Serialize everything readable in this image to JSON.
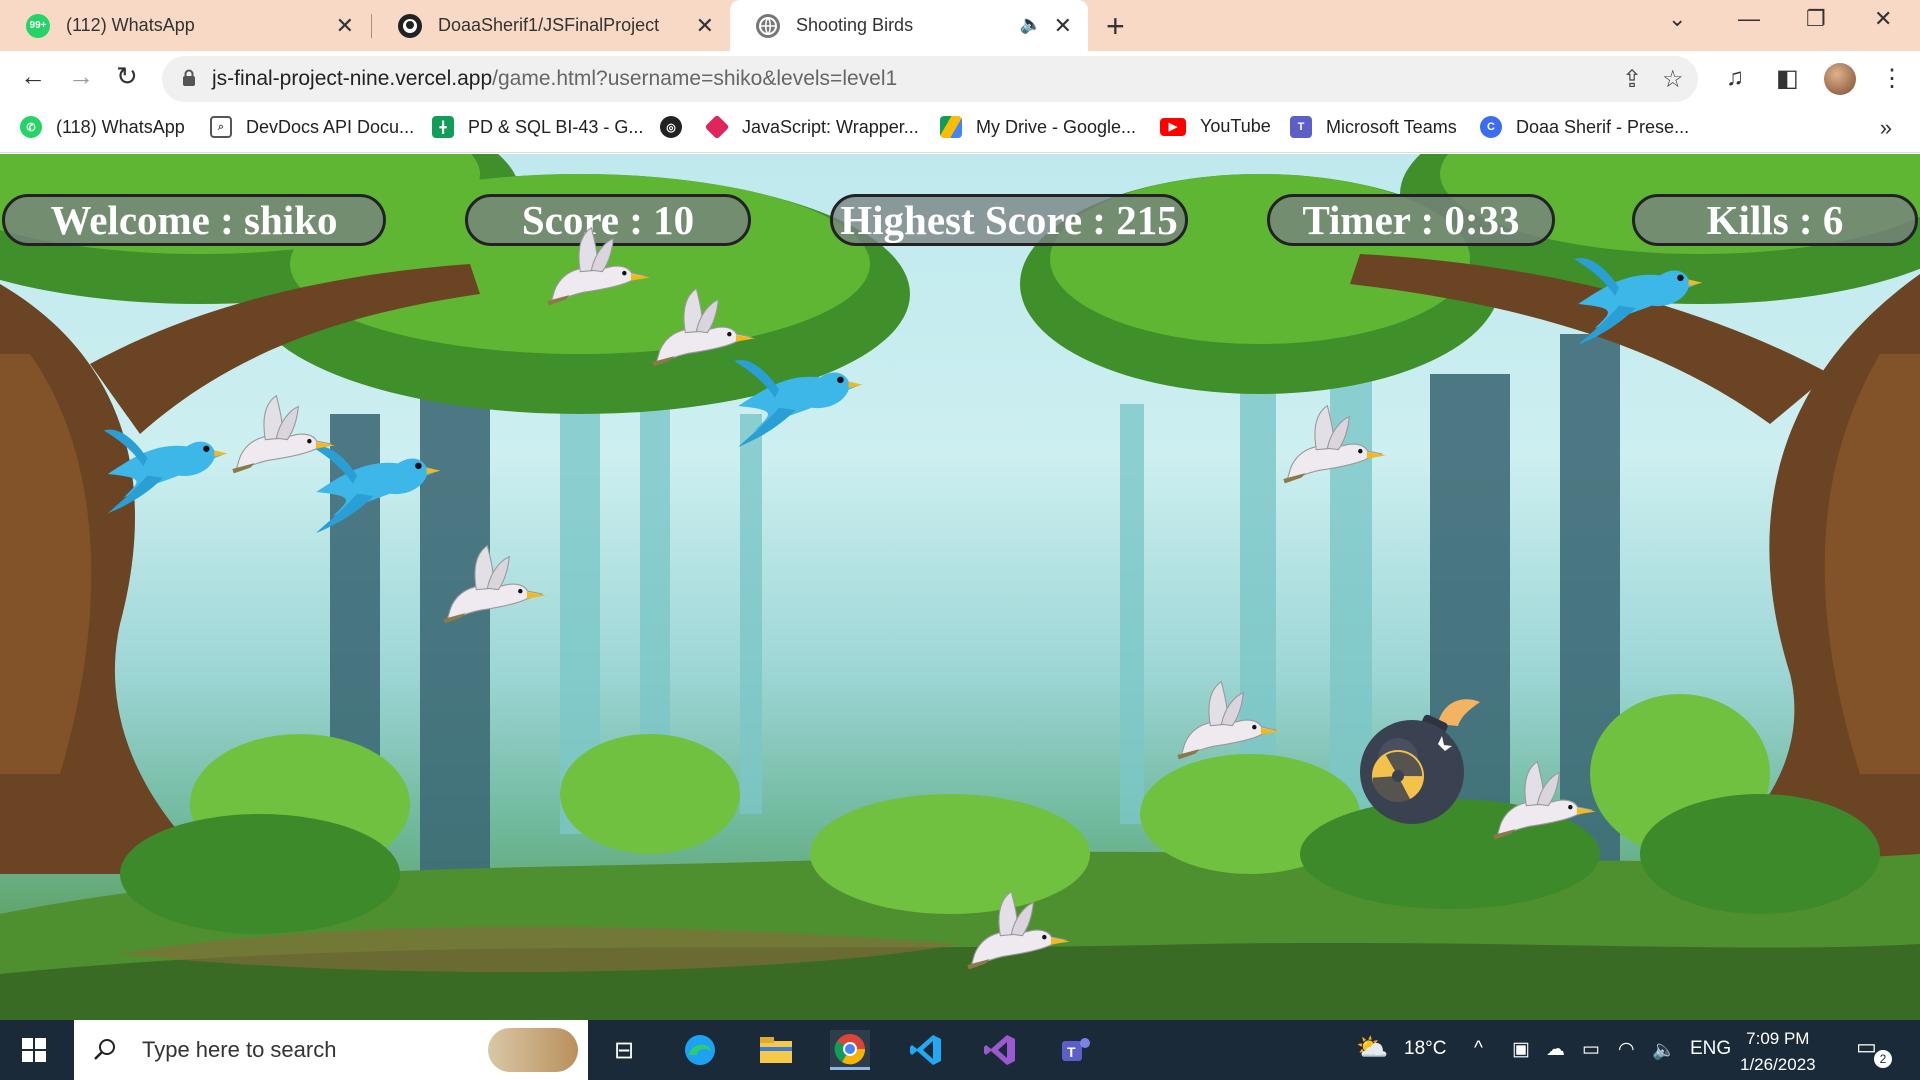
{
  "browser": {
    "tabs": [
      {
        "title": "(112) WhatsApp",
        "favicon": "whatsapp-icon",
        "badge": "99+",
        "active": false
      },
      {
        "title": "DoaaSherif1/JSFinalProject",
        "favicon": "github-icon",
        "active": false
      },
      {
        "title": "Shooting Birds",
        "favicon": "globe-icon",
        "audio": true,
        "active": true
      }
    ],
    "url": {
      "host": "js-final-project-nine.vercel.app",
      "path": "/game.html?username=shiko&levels=level1"
    },
    "bookmarks": [
      {
        "label": "(118) WhatsApp",
        "icon": "whatsapp-icon"
      },
      {
        "label": "DevDocs API Docu...",
        "icon": "devdocs-icon"
      },
      {
        "label": "PD & SQL BI-43 - G...",
        "icon": "sheets-icon"
      },
      {
        "label": "",
        "icon": "globe-icon"
      },
      {
        "label": "JavaScript: Wrapper...",
        "icon": "ruby-gem-icon"
      },
      {
        "label": "My Drive - Google...",
        "icon": "drive-icon"
      },
      {
        "label": "YouTube",
        "icon": "youtube-icon"
      },
      {
        "label": "Microsoft Teams",
        "icon": "teams-icon"
      },
      {
        "label": "Doaa Sherif - Prese...",
        "icon": "canva-icon"
      }
    ]
  },
  "game": {
    "hud": {
      "welcome": "Welcome : shiko",
      "score": "Score : 10",
      "highest": "Highest Score : 215",
      "timer": "Timer : 0:33",
      "kills": "Kills : 6"
    }
  },
  "taskbar": {
    "search_placeholder": "Type here to search",
    "weather": "18°C",
    "language": "ENG",
    "time": "7:09 PM",
    "date": "1/26/2023",
    "notifications": "2"
  },
  "colors": {
    "tabstrip": "#f7d9c6",
    "hud_bg": "#787f80",
    "blue_bird": "#3db6e8",
    "white_bird": "#e8e4ea",
    "taskbar": "#1b2a38"
  }
}
